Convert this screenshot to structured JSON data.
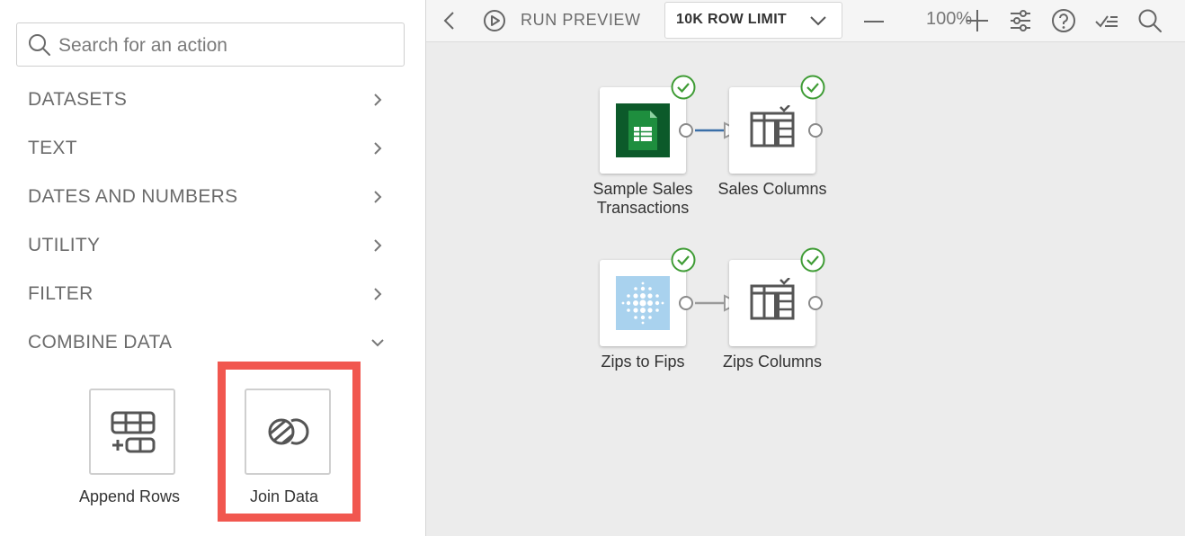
{
  "sidebar": {
    "search": {
      "placeholder": "Search for an action",
      "value": ""
    },
    "categories": [
      {
        "label": "DATASETS",
        "state": "collapsed"
      },
      {
        "label": "TEXT",
        "state": "collapsed"
      },
      {
        "label": "DATES AND NUMBERS",
        "state": "collapsed"
      },
      {
        "label": "UTILITY",
        "state": "collapsed"
      },
      {
        "label": "FILTER",
        "state": "collapsed"
      },
      {
        "label": "COMBINE DATA",
        "state": "expanded"
      }
    ],
    "combine_actions": [
      {
        "label": "Append Rows",
        "icon": "append-rows-icon"
      },
      {
        "label": "Join Data",
        "icon": "join-data-icon",
        "highlighted": true
      }
    ]
  },
  "toolbar": {
    "run_preview": "RUN PREVIEW",
    "row_limit": "10K ROW LIMIT",
    "zoom": "100%"
  },
  "canvas": {
    "nodes": [
      {
        "label": "Sample Sales Transactions",
        "icon": "google-sheets-icon",
        "status": "success"
      },
      {
        "label": "Sales Columns",
        "icon": "select-columns-icon",
        "status": "success"
      },
      {
        "label": "Zips to Fips",
        "icon": "dataset-dots-icon",
        "status": "success"
      },
      {
        "label": "Zips Columns",
        "icon": "select-columns-icon",
        "status": "success"
      }
    ]
  },
  "colors": {
    "highlight": "#f1574f",
    "success": "#3f9c35",
    "sheets_green": "#1e8e3e",
    "connector_blue": "#3a6fa8"
  }
}
